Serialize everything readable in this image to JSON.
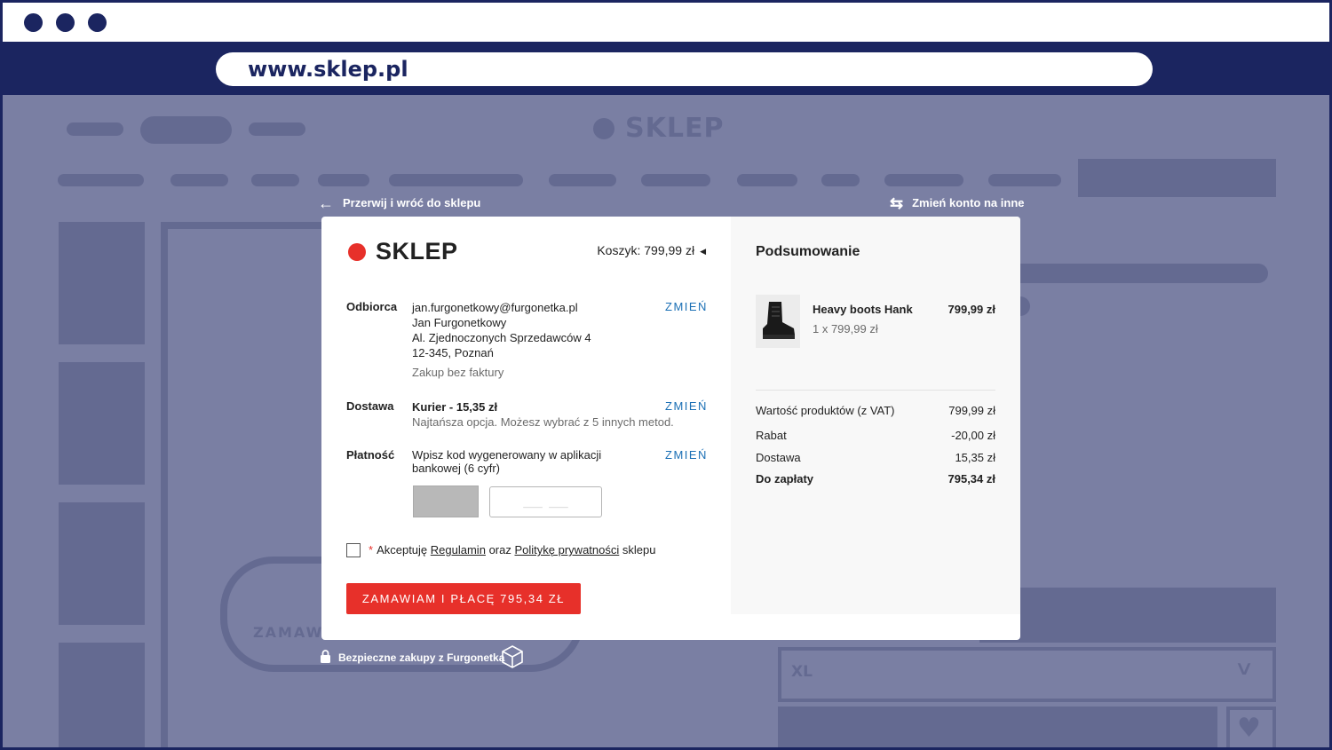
{
  "browser": {
    "url": "www.sklep.pl"
  },
  "background_shop": {
    "logo": "SKLEP",
    "size_select_value": "XL",
    "faded_button_text": "ZAMAW"
  },
  "checkout": {
    "back_link": "Przerwij i wróć do sklepu",
    "switch_account_link": "Zmień konto na inne",
    "shop_logo": "SKLEP",
    "cart": "Koszyk: 799,99 zł",
    "recipient": {
      "label": "Odbiorca",
      "email": "jan.furgonetkowy@furgonetka.pl",
      "name": "Jan Furgonetkowy",
      "street": "Al. Zjednoczonych Sprzedawców 4",
      "city": "12-345, Poznań",
      "invoice": "Zakup bez faktury",
      "change": "ZMIEŃ"
    },
    "delivery": {
      "label": "Dostawa",
      "method": "Kurier  - 15,35 zł",
      "note": "Najtańsza opcja. Możesz wybrać z 5 innych metod.",
      "change": "ZMIEŃ"
    },
    "payment": {
      "label": "Płatność",
      "line1": "Wpisz kod wygenerowany w aplikacji",
      "line2": "bankowej (6 cyfr)",
      "code_placeholder": "___ ___",
      "change": "ZMIEŃ"
    },
    "terms": {
      "star": "*",
      "text1": "Akceptuję",
      "link1": "Regulamin",
      "text2": "oraz",
      "link2": "Politykę prywatności",
      "text3": "sklepu"
    },
    "order_button": "ZAMAWIAM I PŁACĘ 795,34 ZŁ",
    "secure_text": "Bezpieczne zakupy z",
    "secure_brand": "Furgonetka"
  },
  "summary": {
    "title": "Podsumowanie",
    "product": {
      "name": "Heavy boots Hank",
      "qty": "1 x 799,99 zł",
      "price": "799,99 zł"
    },
    "rows": [
      {
        "label": "Wartość produktów (z VAT)",
        "value": "799,99 zł"
      },
      {
        "label": "Rabat",
        "value": "-20,00 zł"
      },
      {
        "label": "Dostawa",
        "value": "15,35 zł"
      },
      {
        "label": "Do zapłaty",
        "value": "795,34 zł"
      }
    ]
  },
  "colors": {
    "navy": "#1b2560",
    "accent_red": "#e7302a",
    "link_blue": "#1a6fb5"
  }
}
